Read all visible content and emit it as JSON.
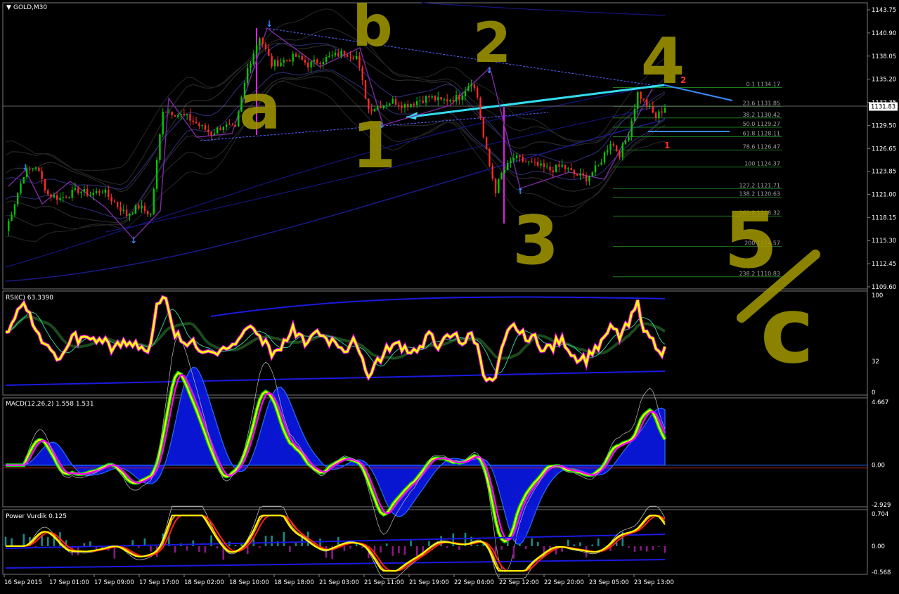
{
  "window": {
    "symbol_title": "GOLD,M30",
    "menu_arrow": "down-triangle-icon"
  },
  "colors": {
    "background": "#000000",
    "bull": "#00c800",
    "bear": "#ff2a2a",
    "fib": "#1e7a1e",
    "fib_text": "#a0a0a0",
    "cyan_line": "#33ddf0",
    "handwriting": "#9e9500",
    "rsi": "#ffff00",
    "macd_hist": "#0a18e8",
    "macd_signal": "#ff00ff",
    "macd_line": "#ffff00",
    "band": "#1a1a8a",
    "axis_text": "#ffffff"
  },
  "chart_data": [
    {
      "type": "candlestick",
      "title": "GOLD,M30",
      "ylim": [
        1109.6,
        1143.75
      ],
      "y_ticks": [
        "1143.75",
        "1140.90",
        "1138.05",
        "1135.20",
        "1132.35",
        "1129.50",
        "1126.65",
        "1123.85",
        "1121.00",
        "1118.15",
        "1115.30",
        "1112.45",
        "1109.60"
      ],
      "current_price": "1131.83",
      "x_ticks": [
        "16 Sep 2015",
        "17 Sep 01:00",
        "17 Sep 09:00",
        "17 Sep 17:00",
        "18 Sep 02:00",
        "18 Sep 10:00",
        "18 Sep 18:00",
        "21 Sep 03:00",
        "21 Sep 11:00",
        "21 Sep 19:00",
        "22 Sep 04:00",
        "22 Sep 12:00",
        "22 Sep 20:00",
        "23 Sep 05:00",
        "23 Sep 13:00"
      ],
      "price_path": [
        [
          0,
          1116.5
        ],
        [
          6,
          1123.5
        ],
        [
          10,
          1124.5
        ],
        [
          14,
          1121.0
        ],
        [
          18,
          1120.5
        ],
        [
          24,
          1121.5
        ],
        [
          28,
          1121.0
        ],
        [
          32,
          1121.5
        ],
        [
          36,
          1120.0
        ],
        [
          40,
          1118.5
        ],
        [
          44,
          1119.5
        ],
        [
          48,
          1118.5
        ],
        [
          52,
          1131.5
        ],
        [
          56,
          1131.0
        ],
        [
          60,
          1130.5
        ],
        [
          64,
          1129.5
        ],
        [
          68,
          1128.5
        ],
        [
          72,
          1129.5
        ],
        [
          76,
          1129.0
        ],
        [
          80,
          1136.5
        ],
        [
          84,
          1140.5
        ],
        [
          88,
          1137.0
        ],
        [
          92,
          1137.5
        ],
        [
          96,
          1138.0
        ],
        [
          100,
          1137.0
        ],
        [
          104,
          1137.5
        ],
        [
          108,
          1138.0
        ],
        [
          112,
          1138.5
        ],
        [
          116,
          1138.0
        ],
        [
          120,
          1131.5
        ],
        [
          124,
          1132.0
        ],
        [
          128,
          1132.5
        ],
        [
          132,
          1132.0
        ],
        [
          136,
          1132.5
        ],
        [
          140,
          1133.0
        ],
        [
          144,
          1132.5
        ],
        [
          150,
          1133.0
        ],
        [
          154,
          1135.0
        ],
        [
          156,
          1133.0
        ],
        [
          158,
          1128.0
        ],
        [
          160,
          1124.5
        ],
        [
          162,
          1121.5
        ],
        [
          164,
          1123.5
        ],
        [
          168,
          1125.5
        ],
        [
          172,
          1125.0
        ],
        [
          176,
          1124.5
        ],
        [
          180,
          1124.0
        ],
        [
          184,
          1124.5
        ],
        [
          188,
          1123.5
        ],
        [
          192,
          1123.0
        ],
        [
          196,
          1124.5
        ],
        [
          200,
          1127.5
        ],
        [
          203,
          1126.0
        ],
        [
          206,
          1128.5
        ],
        [
          209,
          1133.5
        ],
        [
          212,
          1132.0
        ],
        [
          215,
          1130.5
        ],
        [
          218,
          1131.8
        ]
      ],
      "price_path_note_units": "x is bar index (0-218), y is price",
      "fib_levels": [
        {
          "label": "0.1 1134.17",
          "price": 1134.17
        },
        {
          "label": "23.6 1131.85",
          "price": 1131.85
        },
        {
          "label": "38.2 1130.42",
          "price": 1130.42
        },
        {
          "label": "50.0 1129.27",
          "price": 1129.27
        },
        {
          "label": "61.8 1128.11",
          "price": 1128.11
        },
        {
          "label": "78.6 1126.47",
          "price": 1126.47
        },
        {
          "label": "100 1124.37",
          "price": 1124.37
        },
        {
          "label": "127.2 1121.71",
          "price": 1121.71
        },
        {
          "label": "138.2 1120.63",
          "price": 1120.63
        },
        {
          "label": "161.8 1118.32",
          "price": 1118.32
        },
        {
          "label": "200 1114.57",
          "price": 1114.57
        },
        {
          "label": "238.2 1110.83",
          "price": 1110.83
        }
      ],
      "wave_marks": [
        "1",
        "2"
      ],
      "handwritten_labels": [
        "a",
        "b",
        "1",
        "2",
        "3",
        "4",
        "5",
        "c"
      ]
    },
    {
      "type": "line",
      "title": "RSI(C) 63.3390",
      "ylim": [
        0,
        100
      ],
      "y_ticks": [
        "100",
        "32",
        "0"
      ]
    },
    {
      "type": "area",
      "title": "MACD(12,26,2) 1.558 1.531",
      "ylim": [
        -2.929,
        4.667
      ],
      "y_ticks": [
        "4.667",
        "0.00",
        "-2.929"
      ]
    },
    {
      "type": "line",
      "title": "Power Vurdik 0.125",
      "ylim": [
        -0.568,
        0.704
      ],
      "y_ticks": [
        "0.704",
        "0.00",
        "-0.568"
      ]
    }
  ]
}
